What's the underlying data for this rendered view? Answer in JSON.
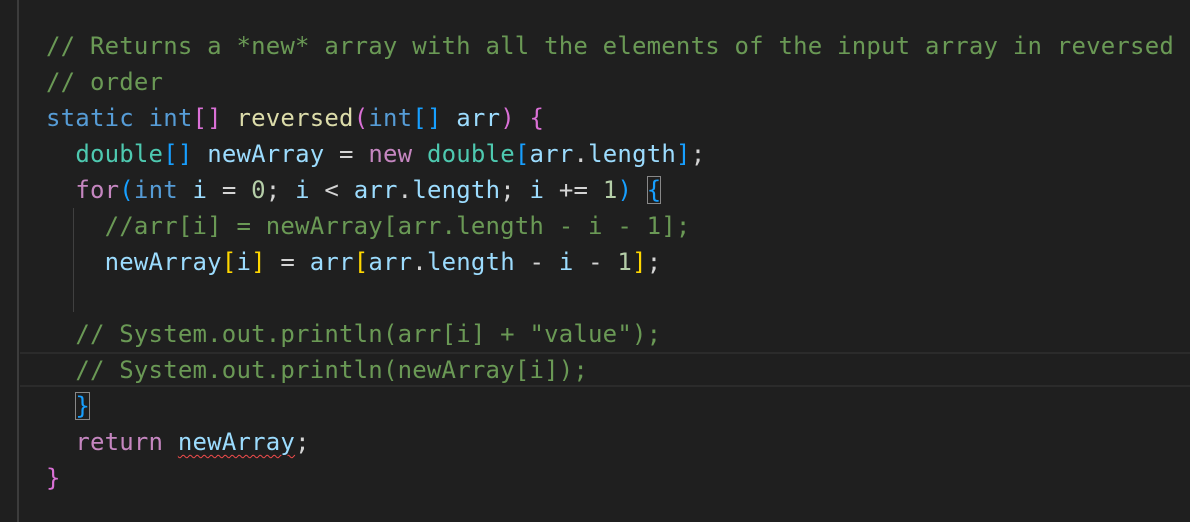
{
  "editor": {
    "colors": {
      "background": "#1f1f1f",
      "comment": "#6a9955",
      "keyword": "#569cd6",
      "type": "#4ec9b0",
      "function": "#dcdcaa",
      "variable": "#9cdcfe",
      "number": "#b5cea8",
      "control": "#c586c0",
      "error_squiggle": "#f14c4c"
    },
    "lines": {
      "l1": "// Returns a *new* array with all the elements of the input array in reversed",
      "l2": "// order",
      "l3": {
        "static": "static",
        "int1": "int",
        "br_open": "[",
        "br_close": "]",
        "name": "reversed",
        "paren_open": "(",
        "int2": "int",
        "br2_open": "[",
        "br2_close": "]",
        "param": "arr",
        "paren_close": ")",
        "brace": "{"
      },
      "l4": {
        "type": "double",
        "br_open": "[",
        "br_close": "]",
        "var": "newArray",
        "eq": " = ",
        "new": "new",
        "type2": "double",
        "br2_open": "[",
        "arr": "arr",
        "dot": ".",
        "length": "length",
        "br2_close": "]",
        "semi": ";"
      },
      "l5": {
        "for": "for",
        "paren_open": "(",
        "int": "int",
        "i1": "i",
        "eq": " = ",
        "zero": "0",
        "semi1": "; ",
        "i2": "i",
        "lt": " < ",
        "arr": "arr",
        "dot": ".",
        "length": "length",
        "semi2": "; ",
        "i3": "i",
        "pluseq": " += ",
        "one": "1",
        "paren_close": ")",
        "brace": "{"
      },
      "l6": "//arr[i] = newArray[arr.length - i - 1];",
      "l7": {
        "var": "newArray",
        "br_open": "[",
        "i": "i",
        "br_close": "]",
        "eq": " = ",
        "arr": "arr",
        "br2_open": "[",
        "arr2": "arr",
        "dot": ".",
        "length": "length",
        "minus1": " - ",
        "i2": "i",
        "minus2": " - ",
        "one": "1",
        "br2_close": "]",
        "semi": ";"
      },
      "l9": "// System.out.println(arr[i] + \"value\");",
      "l10": "// System.out.println(newArray[i]);",
      "l11": "}",
      "l12": {
        "return": "return",
        "var": "newArray",
        "semi": ";"
      },
      "l13": "}"
    }
  }
}
